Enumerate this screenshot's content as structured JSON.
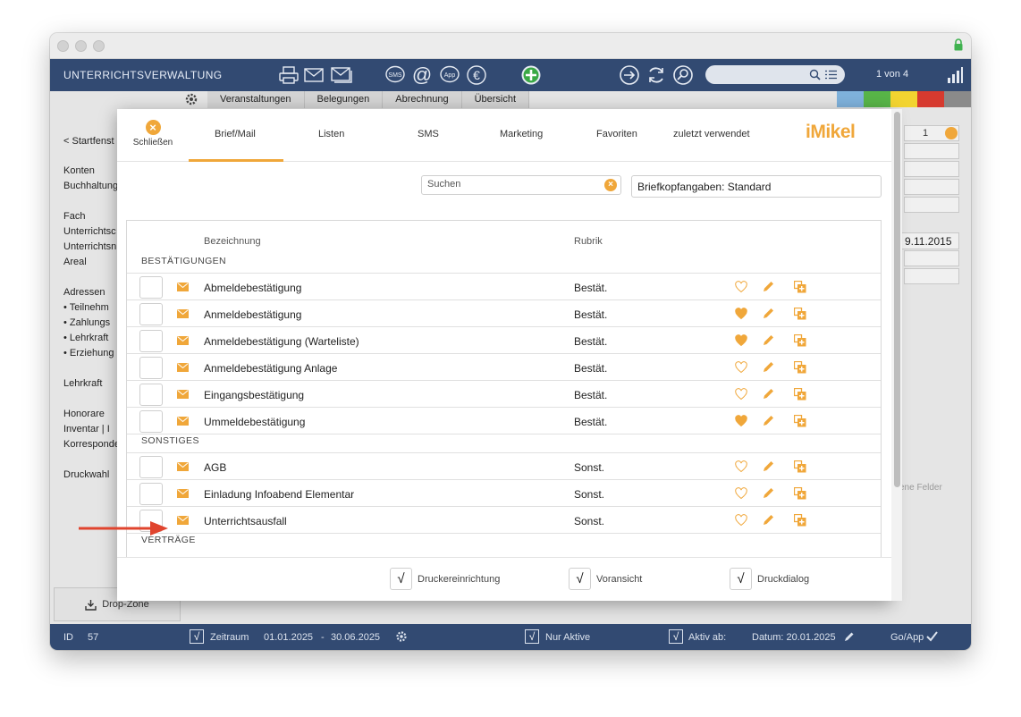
{
  "app": {
    "title": "UNTERRICHTSVERWALTUNG",
    "page_count": "1 von 4",
    "tabs": [
      "Veranstaltungen",
      "Belegungen",
      "Abrechnung",
      "Übersicht"
    ],
    "left_nav": [
      "< Startfenst",
      "Konten",
      "Buchhaltung",
      "Fach",
      "Unterrichtsc",
      "Unterrichtsn",
      "Areal",
      "Adressen",
      "• Teilnehm",
      "• Zahlungs",
      "• Lehrkraft",
      "• Erziehung",
      "Lehrkraft",
      "Honorare",
      "Inventar | I",
      "Korresponde",
      "Druckwahl"
    ],
    "bg_date": "9.11.2015",
    "bg_qty": "1",
    "bg_felder": "ene Felder",
    "drop_zone": "Drop-Zone"
  },
  "statusbar": {
    "id_label": "ID",
    "id_value": "57",
    "zeitraum_label": "Zeitraum",
    "zeitraum_from": "01.01.2025",
    "zeitraum_sep": "-",
    "zeitraum_to": "30.06.2025",
    "nur_aktive": "Nur Aktive",
    "aktiv_ab": "Aktiv ab:",
    "datum": "Datum: 20.01.2025",
    "goapp": "Go/App"
  },
  "modal": {
    "close_label": "Schließen",
    "tabs": [
      "Brief/Mail",
      "Listen",
      "SMS",
      "Marketing",
      "Favoriten",
      "zuletzt verwendet"
    ],
    "active_tab": "Brief/Mail",
    "logo": "iMikel",
    "search_placeholder": "Suchen",
    "letterhead": "Briefkopfangaben: Standard",
    "col_bezeichnung": "Bezeichnung",
    "col_rubrik": "Rubrik",
    "groups": [
      {
        "title": "BESTÄTIGUNGEN",
        "rows": [
          {
            "name": "Abmeldebestätigung",
            "rubrik": "Bestät.",
            "favorite": false
          },
          {
            "name": "Anmeldebestätigung",
            "rubrik": "Bestät.",
            "favorite": true
          },
          {
            "name": "Anmeldebestätigung (Warteliste)",
            "rubrik": "Bestät.",
            "favorite": true
          },
          {
            "name": "Anmeldebestätigung Anlage",
            "rubrik": "Bestät.",
            "favorite": false
          },
          {
            "name": "Eingangsbestätigung",
            "rubrik": "Bestät.",
            "favorite": false
          },
          {
            "name": "Ummeldebestätigung",
            "rubrik": "Bestät.",
            "favorite": true
          }
        ]
      },
      {
        "title": "SONSTIGES",
        "rows": [
          {
            "name": "AGB",
            "rubrik": "Sonst.",
            "favorite": false
          },
          {
            "name": "Einladung Infoabend Elementar",
            "rubrik": "Sonst.",
            "favorite": false
          },
          {
            "name": "Unterrichtsausfall",
            "rubrik": "Sonst.",
            "favorite": false
          }
        ]
      },
      {
        "title": "VERTRÄGE",
        "rows": []
      }
    ],
    "footer": {
      "druckereinrichtung": "Druckereinrichtung",
      "voransicht": "Voransicht",
      "druckdialog": "Druckdialog",
      "check_mark": "√"
    }
  },
  "colors": {
    "accent": "#f0a73a",
    "navy": "#324a72",
    "arrow": "#e0442e"
  }
}
